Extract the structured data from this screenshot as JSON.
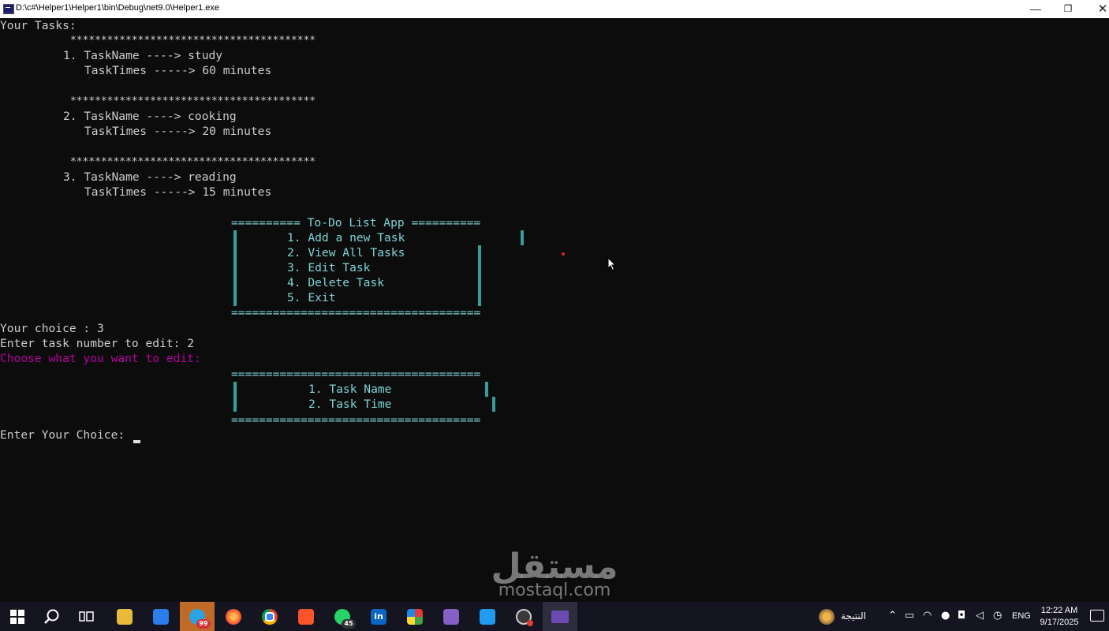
{
  "window": {
    "title": "D:\\c#\\Helper1\\Helper1\\bin\\Debug\\net9.0\\Helper1.exe",
    "minimize": "—",
    "maximize": "❐",
    "close": "✕"
  },
  "console": {
    "header": "Your Tasks:",
    "separator": "****************************************",
    "tasks": [
      {
        "name_line": "1. TaskName ----> study",
        "time_line": "TaskTimes -----> 60 minutes"
      },
      {
        "name_line": "2. TaskName ----> cooking",
        "time_line": "TaskTimes -----> 20 minutes"
      },
      {
        "name_line": "3. TaskName ----> reading",
        "time_line": "TaskTimes -----> 15 minutes"
      }
    ],
    "menu": {
      "top": "========== To-Do List App ==========",
      "items": [
        "1. Add a new Task",
        "2. View All Tasks",
        "3. Edit Task",
        "4. Delete Task",
        "5. Exit"
      ],
      "bottom": "===================================="
    },
    "choice_line": "Your choice : 3",
    "task_number_line": "Enter task number to edit: 2",
    "choose_prompt": "Choose what you want to edit:",
    "edit_menu": {
      "top": "====================================",
      "items": [
        "1. Task Name",
        "2. Task Time"
      ],
      "bottom": "===================================="
    },
    "enter_choice": "Enter Your Choice: "
  },
  "watermark": {
    "arabic": "مستقل",
    "latin": "mostaql.com"
  },
  "taskbar": {
    "apps": [
      {
        "name": "windows-start",
        "icon": "windows-logo-icon"
      },
      {
        "name": "search",
        "icon": "search-icon"
      },
      {
        "name": "task-view",
        "icon": "task-view-icon"
      },
      {
        "name": "file-explorer",
        "icon": "folder-icon"
      },
      {
        "name": "microsoft-store",
        "icon": "store-icon"
      },
      {
        "name": "telegram",
        "icon": "telegram-icon",
        "badge": "99"
      },
      {
        "name": "firefox",
        "icon": "firefox-icon"
      },
      {
        "name": "chrome",
        "icon": "chrome-icon"
      },
      {
        "name": "brave",
        "icon": "brave-icon"
      },
      {
        "name": "whatsapp",
        "icon": "whatsapp-icon",
        "badge": "45"
      },
      {
        "name": "linkedin",
        "icon": "linkedin-icon",
        "label": "in"
      },
      {
        "name": "colorful-app",
        "icon": "colorful-app-icon"
      },
      {
        "name": "visual-studio",
        "icon": "visual-studio-icon"
      },
      {
        "name": "vscode",
        "icon": "vscode-icon"
      },
      {
        "name": "screen-recorder",
        "icon": "recorder-icon"
      },
      {
        "name": "console-app",
        "icon": "console-app-icon"
      }
    ],
    "tray": {
      "weather_label": "النتيجة",
      "language": "ENG",
      "time": "12:22 AM",
      "date": "9/17/2025"
    }
  }
}
